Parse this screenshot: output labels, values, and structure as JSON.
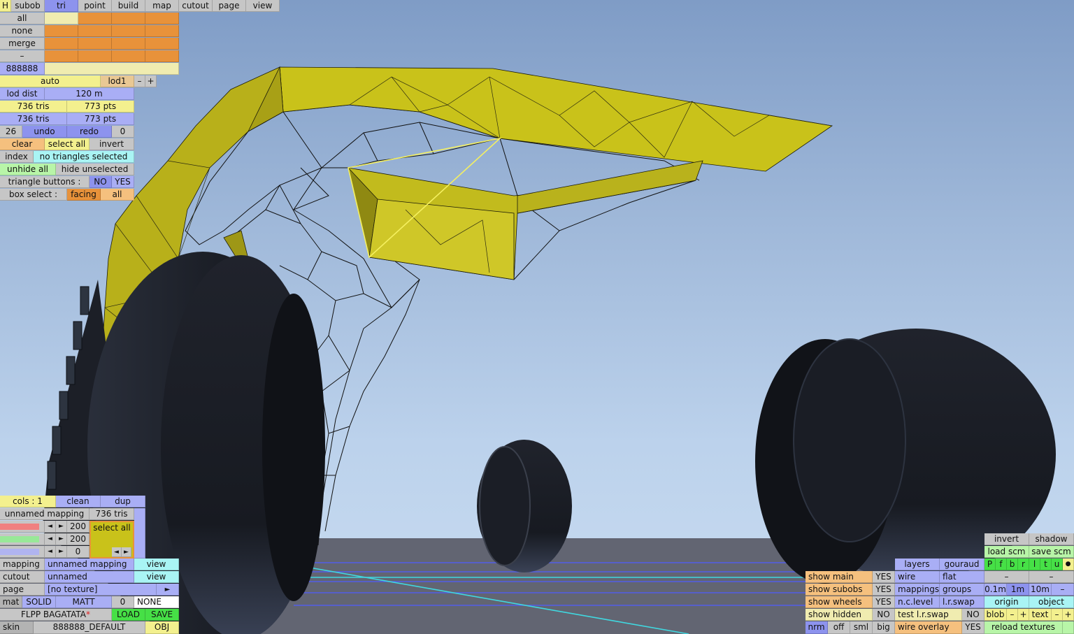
{
  "colors": {
    "sky_top": "#7f9cc6",
    "sky_bottom": "#c9dcf0",
    "mesh_yellow": "#c9c21a",
    "selection": "#f5f060",
    "grid_blue": "#4f5cff",
    "grid_cyan": "#40d8e0",
    "ground": "#626572"
  },
  "top_menu": {
    "h": "H",
    "items": [
      "subob",
      "tri",
      "point",
      "build",
      "map",
      "cutout",
      "page",
      "view"
    ]
  },
  "select_panel": {
    "rows": [
      "all",
      "none",
      "merge",
      "–"
    ],
    "color_code": "888888",
    "auto": "auto",
    "lod": "lod1",
    "minus": "–",
    "plus": "+",
    "lod_dist_label": "lod dist",
    "lod_dist_value": "120 m",
    "tris_a": "736 tris",
    "pts_a": "773 pts",
    "tris_b": "736 tris",
    "pts_b": "773 pts",
    "undo_count": "26",
    "undo": "undo",
    "redo": "redo",
    "redo_count": "0",
    "clear": "clear",
    "select_all": "select all",
    "invert": "invert",
    "index": "index",
    "selection_status": "no triangles selected",
    "unhide_all": "unhide all",
    "hide_unselected": "hide unselected",
    "triangle_buttons": "triangle buttons :",
    "no": "NO",
    "yes": "YES",
    "box_select": "box select :",
    "facing": "facing",
    "all": "all"
  },
  "mapping_panel": {
    "cols": "cols : 1",
    "clean": "clean",
    "dup": "dup",
    "mapping_name": "unnamed mapping",
    "tris": "736 tris",
    "val_a": "200",
    "val_b": "200",
    "val_c": "0",
    "select_all": "select all",
    "arrow_left": "◄",
    "arrow_right": "►"
  },
  "bottom_left": {
    "mapping_label": "mapping",
    "mapping_value": "unnamed mapping",
    "view": "view",
    "cutout_label": "cutout",
    "cutout_value": "unnamed",
    "page_label": "page",
    "page_value": "[no texture]",
    "page_arrow": "►",
    "mat": "mat",
    "solid": "SOLID",
    "matt": "MATT",
    "mat_num": "0",
    "none": "NONE",
    "file": "FLPP BAGATATA",
    "star": "*",
    "load": "LOAD",
    "save": "SAVE",
    "skin_label": "skin",
    "skin_value": "888888_DEFAULT",
    "obj": "OBJ"
  },
  "bottom_right": {
    "invert": "invert",
    "shadow": "shadow",
    "load_scm": "load scm",
    "save_scm": "save scm",
    "letters": [
      "P",
      "f",
      "b",
      "r",
      "l",
      "t",
      "u"
    ],
    "dot": "●",
    "layers": "layers",
    "gouraud": "gouraud",
    "dash": "–",
    "show_main": "show main",
    "show_subobs": "show subobs",
    "show_wheels": "show wheels",
    "show_hidden": "show hidden",
    "yes": "YES",
    "no": "NO",
    "wire": "wire",
    "flat": "flat",
    "mappings": "mappings",
    "groups": "groups",
    "s01": "0.1m",
    "s1": "1m",
    "s10": "10m",
    "nclevel": "n.c.level",
    "lrswap": "l.r.swap",
    "origin": "origin",
    "object": "object",
    "test_lrswap": "test l.r.swap",
    "blob": "blob",
    "plus": "+",
    "text": "text",
    "nrm": "nrm",
    "off": "off",
    "sml": "sml",
    "big": "big",
    "wire_overlay": "wire overlay",
    "reload_textures": "reload textures"
  }
}
